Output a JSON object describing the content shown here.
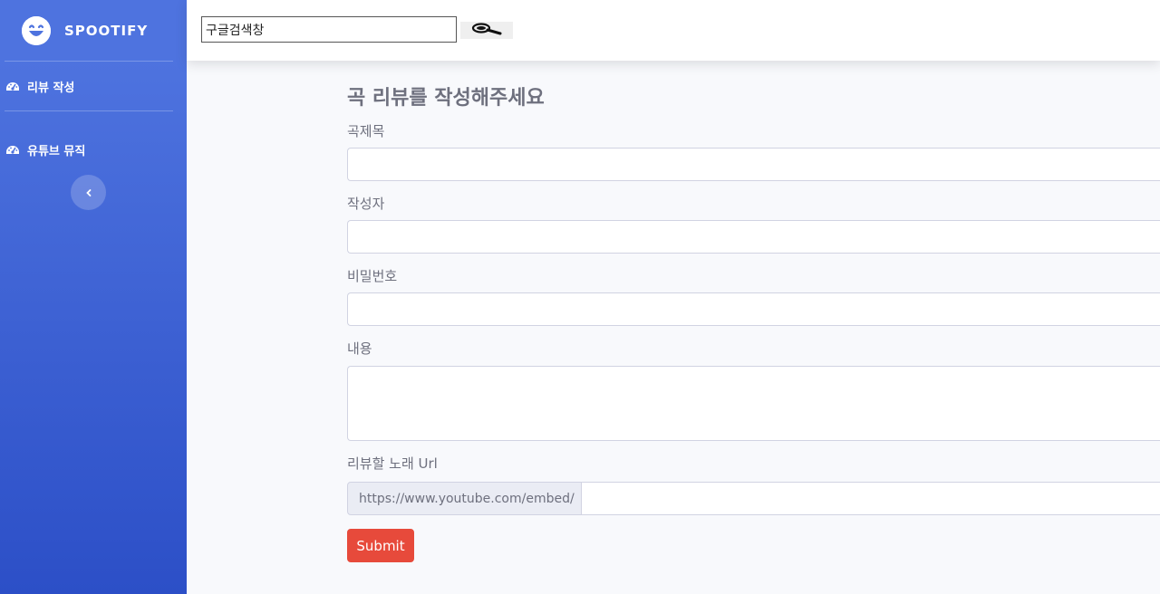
{
  "brand": {
    "name": "SPOOTIFY",
    "icon": "laughing-face-icon"
  },
  "sidebar": {
    "items": [
      {
        "label": "리뷰 작성",
        "icon": "tachometer-icon"
      },
      {
        "label": "유튜브 뮤직",
        "icon": "tachometer-icon"
      }
    ],
    "toggle_icon": "chevron-left-icon"
  },
  "topbar": {
    "search_value": "구글검색창",
    "search_button_icon": "magnifier-icon"
  },
  "form": {
    "title": "곡 리뷰를 작성해주세요",
    "song_title_label": "곡제목",
    "author_label": "작성자",
    "password_label": "비밀번호",
    "content_label": "내용",
    "url_label": "리뷰할 노래 Url",
    "url_prefix": "https://www.youtube.com/embed/",
    "submit_label": "Submit"
  },
  "colors": {
    "sidebar_top": "#4e73df",
    "sidebar_bottom": "#2c4fc7",
    "submit": "#e74a3b",
    "text_muted": "#6e707e"
  }
}
